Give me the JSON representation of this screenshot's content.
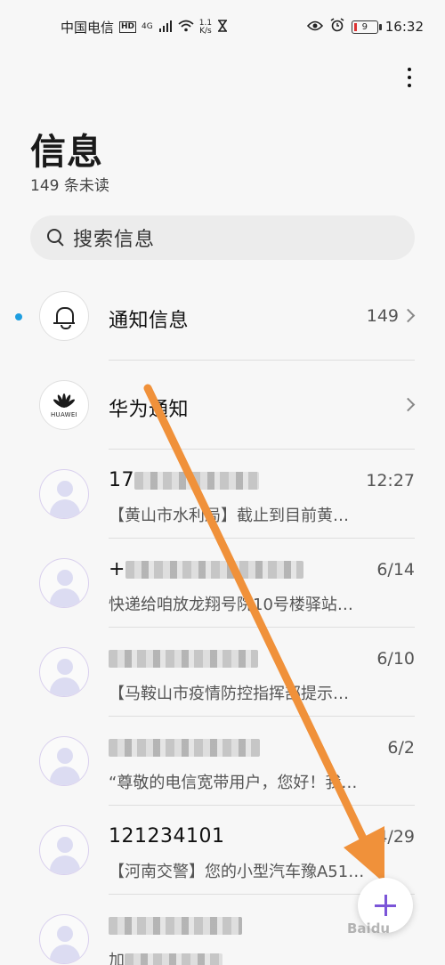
{
  "status_bar": {
    "carrier": "中国电信",
    "hd_badge": "HD",
    "network": "4G",
    "speed_top": "1.1",
    "speed_bottom": "K/s",
    "battery_level": "9",
    "time": "16:32"
  },
  "header": {
    "title": "信息",
    "unread_count_text": "149 条未读"
  },
  "search": {
    "placeholder": "搜索信息"
  },
  "conversations": [
    {
      "name": "通知信息",
      "count": "149",
      "unread": true,
      "icon": "bell-icon"
    },
    {
      "name": "华为通知",
      "icon": "huawei-logo",
      "logo_text": "HUAWEI"
    },
    {
      "name_visible": "17",
      "time": "12:27",
      "preview": "【黄山市水利局】截止到目前黄…",
      "icon": "contact-avatar"
    },
    {
      "name_visible": "+",
      "time": "6/14",
      "preview": "快递给咱放龙翔号院10号楼驿站…",
      "icon": "contact-avatar"
    },
    {
      "time": "6/10",
      "preview": "【马鞍山市疫情防控指挥部提示…",
      "icon": "contact-avatar"
    },
    {
      "time": "6/2",
      "preview": "“尊敬的电信宽带用户，您好！我…",
      "icon": "contact-avatar"
    },
    {
      "name": "121234101",
      "time": "4/29",
      "preview": "【河南交警】您的小型汽车豫A51…",
      "icon": "contact-avatar"
    },
    {
      "preview": "加",
      "icon": "contact-avatar"
    }
  ],
  "fab": {
    "icon": "plus-icon"
  },
  "watermark": "Baidu",
  "colors": {
    "accent": "#7b55d8",
    "unread_dot": "#1e9ee0",
    "annotation_arrow": "#f0913a"
  }
}
